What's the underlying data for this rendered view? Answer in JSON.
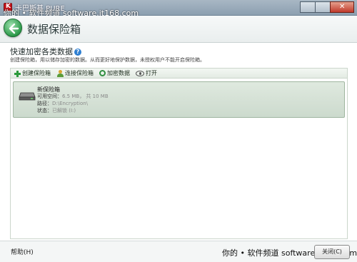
{
  "window": {
    "app_title": "卡巴斯基 PURE",
    "watermark_top": "你的 • 软件频道 software.it168.com",
    "watermark_bottom": "你的 • 软件频道 software.it168.com"
  },
  "header": {
    "title": "数据保险箱"
  },
  "section": {
    "title": "快速加密各类数据",
    "description": "创建保险箱，用以储存加密的数据。从而更好地保护数据，未授权用户不能开启保险箱。"
  },
  "toolbar": {
    "items": [
      {
        "label": "创建保险箱",
        "icon": "plus-icon"
      },
      {
        "label": "连接保险箱",
        "icon": "person-icon"
      },
      {
        "label": "加密数据",
        "icon": "encrypt-icon"
      },
      {
        "label": "打开",
        "icon": "eye-icon"
      }
    ]
  },
  "vaults": [
    {
      "name": "新保险箱",
      "space_label": "可用空间：",
      "space_value": "6.5 MB， 共 10 MB",
      "path_label": "路径：",
      "path_value": "D:\\Encryption\\",
      "status_label": "状态：",
      "status_value": "已解锁 (I:)",
      "icon": "drive-icon"
    }
  ],
  "footer": {
    "help_label": "帮助(H)",
    "close_label": "关闭(C)"
  },
  "colors": {
    "accent_green": "#2c9a4a",
    "selection_bg": "#ccdacd",
    "header_bg": "#e9eeee"
  }
}
